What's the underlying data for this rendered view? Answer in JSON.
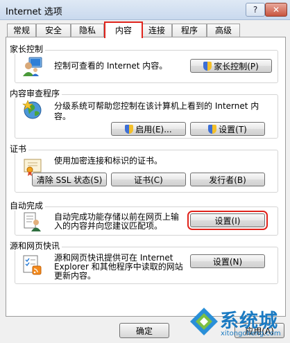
{
  "window": {
    "title": "Internet 选项",
    "help_label": "?",
    "close_label": "✕"
  },
  "tabs": [
    {
      "label": "常规"
    },
    {
      "label": "安全"
    },
    {
      "label": "隐私"
    },
    {
      "label": "内容"
    },
    {
      "label": "连接"
    },
    {
      "label": "程序"
    },
    {
      "label": "高级"
    }
  ],
  "active_tab": "内容",
  "groups": {
    "parental": {
      "title": "家长控制",
      "desc": "控制可查看的 Internet 内容。",
      "button": "家长控制(P)"
    },
    "advisor": {
      "title": "内容审查程序",
      "desc_line1": "分级系统可帮助您控制在该计算机上看到的 Internet 内",
      "desc_line2": "容。",
      "enable": "启用(E)...",
      "settings": "设置(T)"
    },
    "certs": {
      "title": "证书",
      "desc": "使用加密连接和标识的证书。",
      "clear_ssl": "清除 SSL 状态(S)",
      "certificates": "证书(C)",
      "publishers": "发行者(B)"
    },
    "autocomplete": {
      "title": "自动完成",
      "desc_line1": "自动完成功能存储以前在网页上输",
      "desc_line2": "入的内容并向您建议匹配项。",
      "settings": "设置(I)"
    },
    "feeds": {
      "title": "源和网页快讯",
      "desc_line1": "源和网页快讯提供可在 Internet",
      "desc_line2": "Explorer 和其他程序中读取的网站",
      "desc_line3": "更新内容。",
      "settings": "设置(N)"
    }
  },
  "footer": {
    "ok": "确定",
    "apply": "应用(A)"
  },
  "watermark": {
    "brand": "系统城",
    "url": "xitongcheng.com"
  },
  "accent_colors": {
    "highlight": "#e0231b",
    "watermark": "#1a7ac2"
  }
}
